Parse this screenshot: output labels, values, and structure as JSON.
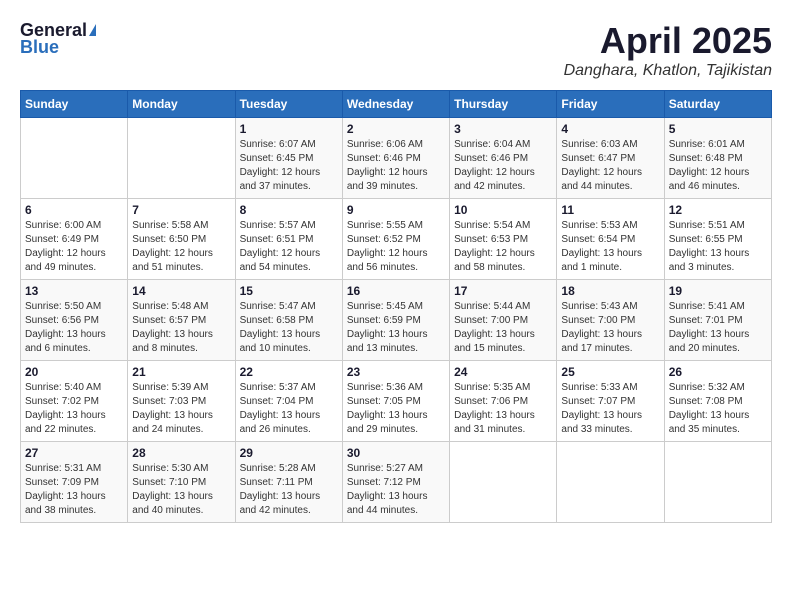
{
  "header": {
    "logo_general": "General",
    "logo_blue": "Blue",
    "title": "April 2025",
    "location": "Danghara, Khatlon, Tajikistan"
  },
  "calendar": {
    "weekdays": [
      "Sunday",
      "Monday",
      "Tuesday",
      "Wednesday",
      "Thursday",
      "Friday",
      "Saturday"
    ],
    "weeks": [
      [
        {
          "date": "",
          "sunrise": "",
          "sunset": "",
          "daylight": ""
        },
        {
          "date": "",
          "sunrise": "",
          "sunset": "",
          "daylight": ""
        },
        {
          "date": "1",
          "sunrise": "Sunrise: 6:07 AM",
          "sunset": "Sunset: 6:45 PM",
          "daylight": "Daylight: 12 hours and 37 minutes."
        },
        {
          "date": "2",
          "sunrise": "Sunrise: 6:06 AM",
          "sunset": "Sunset: 6:46 PM",
          "daylight": "Daylight: 12 hours and 39 minutes."
        },
        {
          "date": "3",
          "sunrise": "Sunrise: 6:04 AM",
          "sunset": "Sunset: 6:46 PM",
          "daylight": "Daylight: 12 hours and 42 minutes."
        },
        {
          "date": "4",
          "sunrise": "Sunrise: 6:03 AM",
          "sunset": "Sunset: 6:47 PM",
          "daylight": "Daylight: 12 hours and 44 minutes."
        },
        {
          "date": "5",
          "sunrise": "Sunrise: 6:01 AM",
          "sunset": "Sunset: 6:48 PM",
          "daylight": "Daylight: 12 hours and 46 minutes."
        }
      ],
      [
        {
          "date": "6",
          "sunrise": "Sunrise: 6:00 AM",
          "sunset": "Sunset: 6:49 PM",
          "daylight": "Daylight: 12 hours and 49 minutes."
        },
        {
          "date": "7",
          "sunrise": "Sunrise: 5:58 AM",
          "sunset": "Sunset: 6:50 PM",
          "daylight": "Daylight: 12 hours and 51 minutes."
        },
        {
          "date": "8",
          "sunrise": "Sunrise: 5:57 AM",
          "sunset": "Sunset: 6:51 PM",
          "daylight": "Daylight: 12 hours and 54 minutes."
        },
        {
          "date": "9",
          "sunrise": "Sunrise: 5:55 AM",
          "sunset": "Sunset: 6:52 PM",
          "daylight": "Daylight: 12 hours and 56 minutes."
        },
        {
          "date": "10",
          "sunrise": "Sunrise: 5:54 AM",
          "sunset": "Sunset: 6:53 PM",
          "daylight": "Daylight: 12 hours and 58 minutes."
        },
        {
          "date": "11",
          "sunrise": "Sunrise: 5:53 AM",
          "sunset": "Sunset: 6:54 PM",
          "daylight": "Daylight: 13 hours and 1 minute."
        },
        {
          "date": "12",
          "sunrise": "Sunrise: 5:51 AM",
          "sunset": "Sunset: 6:55 PM",
          "daylight": "Daylight: 13 hours and 3 minutes."
        }
      ],
      [
        {
          "date": "13",
          "sunrise": "Sunrise: 5:50 AM",
          "sunset": "Sunset: 6:56 PM",
          "daylight": "Daylight: 13 hours and 6 minutes."
        },
        {
          "date": "14",
          "sunrise": "Sunrise: 5:48 AM",
          "sunset": "Sunset: 6:57 PM",
          "daylight": "Daylight: 13 hours and 8 minutes."
        },
        {
          "date": "15",
          "sunrise": "Sunrise: 5:47 AM",
          "sunset": "Sunset: 6:58 PM",
          "daylight": "Daylight: 13 hours and 10 minutes."
        },
        {
          "date": "16",
          "sunrise": "Sunrise: 5:45 AM",
          "sunset": "Sunset: 6:59 PM",
          "daylight": "Daylight: 13 hours and 13 minutes."
        },
        {
          "date": "17",
          "sunrise": "Sunrise: 5:44 AM",
          "sunset": "Sunset: 7:00 PM",
          "daylight": "Daylight: 13 hours and 15 minutes."
        },
        {
          "date": "18",
          "sunrise": "Sunrise: 5:43 AM",
          "sunset": "Sunset: 7:00 PM",
          "daylight": "Daylight: 13 hours and 17 minutes."
        },
        {
          "date": "19",
          "sunrise": "Sunrise: 5:41 AM",
          "sunset": "Sunset: 7:01 PM",
          "daylight": "Daylight: 13 hours and 20 minutes."
        }
      ],
      [
        {
          "date": "20",
          "sunrise": "Sunrise: 5:40 AM",
          "sunset": "Sunset: 7:02 PM",
          "daylight": "Daylight: 13 hours and 22 minutes."
        },
        {
          "date": "21",
          "sunrise": "Sunrise: 5:39 AM",
          "sunset": "Sunset: 7:03 PM",
          "daylight": "Daylight: 13 hours and 24 minutes."
        },
        {
          "date": "22",
          "sunrise": "Sunrise: 5:37 AM",
          "sunset": "Sunset: 7:04 PM",
          "daylight": "Daylight: 13 hours and 26 minutes."
        },
        {
          "date": "23",
          "sunrise": "Sunrise: 5:36 AM",
          "sunset": "Sunset: 7:05 PM",
          "daylight": "Daylight: 13 hours and 29 minutes."
        },
        {
          "date": "24",
          "sunrise": "Sunrise: 5:35 AM",
          "sunset": "Sunset: 7:06 PM",
          "daylight": "Daylight: 13 hours and 31 minutes."
        },
        {
          "date": "25",
          "sunrise": "Sunrise: 5:33 AM",
          "sunset": "Sunset: 7:07 PM",
          "daylight": "Daylight: 13 hours and 33 minutes."
        },
        {
          "date": "26",
          "sunrise": "Sunrise: 5:32 AM",
          "sunset": "Sunset: 7:08 PM",
          "daylight": "Daylight: 13 hours and 35 minutes."
        }
      ],
      [
        {
          "date": "27",
          "sunrise": "Sunrise: 5:31 AM",
          "sunset": "Sunset: 7:09 PM",
          "daylight": "Daylight: 13 hours and 38 minutes."
        },
        {
          "date": "28",
          "sunrise": "Sunrise: 5:30 AM",
          "sunset": "Sunset: 7:10 PM",
          "daylight": "Daylight: 13 hours and 40 minutes."
        },
        {
          "date": "29",
          "sunrise": "Sunrise: 5:28 AM",
          "sunset": "Sunset: 7:11 PM",
          "daylight": "Daylight: 13 hours and 42 minutes."
        },
        {
          "date": "30",
          "sunrise": "Sunrise: 5:27 AM",
          "sunset": "Sunset: 7:12 PM",
          "daylight": "Daylight: 13 hours and 44 minutes."
        },
        {
          "date": "",
          "sunrise": "",
          "sunset": "",
          "daylight": ""
        },
        {
          "date": "",
          "sunrise": "",
          "sunset": "",
          "daylight": ""
        },
        {
          "date": "",
          "sunrise": "",
          "sunset": "",
          "daylight": ""
        }
      ]
    ]
  }
}
